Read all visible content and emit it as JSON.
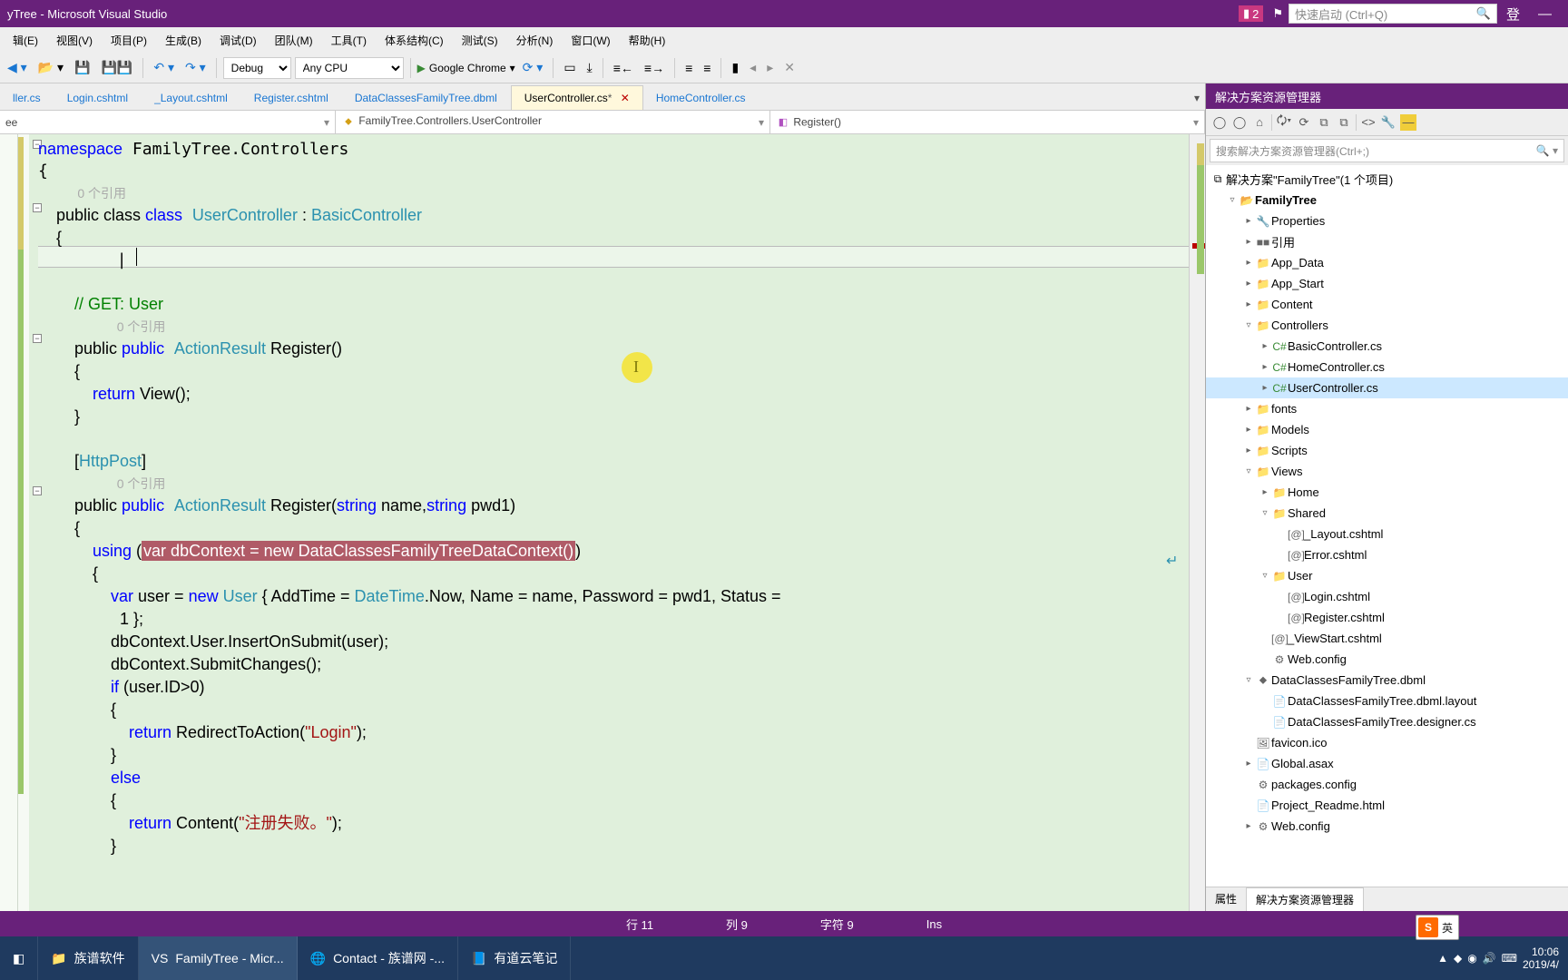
{
  "title": "yTree - Microsoft Visual Studio",
  "notif_badge": "2",
  "quicklaunch_placeholder": "快速启动 (Ctrl+Q)",
  "login_label": "登",
  "menu": [
    "辑(E)",
    "视图(V)",
    "项目(P)",
    "生成(B)",
    "调试(D)",
    "团队(M)",
    "工具(T)",
    "体系结构(C)",
    "测试(S)",
    "分析(N)",
    "窗口(W)",
    "帮助(H)"
  ],
  "toolbar": {
    "config": "Debug",
    "platform": "Any CPU",
    "browser": "Google Chrome"
  },
  "tabs": [
    {
      "label": "ller.cs"
    },
    {
      "label": "Login.cshtml"
    },
    {
      "label": "_Layout.cshtml"
    },
    {
      "label": "Register.cshtml"
    },
    {
      "label": "DataClassesFamilyTree.dbml"
    },
    {
      "label": "UserController.cs",
      "modified": "*",
      "active": true
    },
    {
      "label": "HomeController.cs"
    }
  ],
  "nav": {
    "left": "ee",
    "mid": "FamilyTree.Controllers.UserController",
    "right": "Register()"
  },
  "code": {
    "l1": "namespace FamilyTree.Controllers",
    "l2": "{",
    "ref0": "0 个引用",
    "l3a": "    public class ",
    "l3b": "UserController",
    "l3c": " : ",
    "l3d": "BasicController",
    "l4": "    {",
    "blank": "",
    "l6": "        // GET: User",
    "ref1": "0 个引用",
    "l7a": "        public ",
    "l7b": "ActionResult",
    "l7c": " Register()",
    "l8": "        {",
    "l9a": "            return",
    "l9b": " View();",
    "l10": "        }",
    "l12a": "        [",
    "l12b": "HttpPost",
    "l12c": "]",
    "ref2": "0 个引用",
    "l13a": "        public ",
    "l13b": "ActionResult",
    "l13c": " Register(",
    "l13d": "string",
    "l13e": " name,",
    "l13f": "string",
    "l13g": " pwd1)",
    "l14": "        {",
    "l15a": "            using",
    "l15b": " (",
    "l15c": "var dbContext = new DataClassesFamilyTreeDataContext()",
    "l15d": ")",
    "l16": "            {",
    "l17a": "                var",
    "l17b": " user = ",
    "l17c": "new ",
    "l17d": "User",
    "l17e": " { AddTime = ",
    "l17f": "DateTime",
    "l17g": ".Now, Name = name, Password = pwd1, Status = ",
    "l18": "                  1 };",
    "l19": "                dbContext.User.InsertOnSubmit(user);",
    "l20": "                dbContext.SubmitChanges();",
    "l21a": "                if",
    "l21b": " (user.ID>0)",
    "l22": "                {",
    "l23a": "                    return",
    "l23b": " RedirectToAction(",
    "l23c": "\"Login\"",
    "l23d": ");",
    "l24": "                }",
    "l25a": "                else",
    "l26": "                {",
    "l27a": "                    return",
    "l27b": " Content(",
    "l27c": "\"注册失败。\"",
    "l27d": ");",
    "l28": "                }"
  },
  "sln": {
    "title": "解决方案资源管理器",
    "search_placeholder": "搜索解决方案资源管理器(Ctrl+;)",
    "root": "解决方案\"FamilyTree\"(1 个项目)",
    "tree": [
      {
        "d": 1,
        "t": "▿",
        "i": "📂",
        "n": "FamilyTree",
        "b": true
      },
      {
        "d": 2,
        "t": "▸",
        "i": "🔧",
        "n": "Properties"
      },
      {
        "d": 2,
        "t": "▸",
        "i": "■■",
        "n": "引用"
      },
      {
        "d": 2,
        "t": "▸",
        "i": "📁",
        "n": "App_Data"
      },
      {
        "d": 2,
        "t": "▸",
        "i": "📁",
        "n": "App_Start"
      },
      {
        "d": 2,
        "t": "▸",
        "i": "📁",
        "n": "Content"
      },
      {
        "d": 2,
        "t": "▿",
        "i": "📁",
        "n": "Controllers"
      },
      {
        "d": 3,
        "t": "▸",
        "i": "C#",
        "n": "BasicController.cs",
        "cs": true
      },
      {
        "d": 3,
        "t": "▸",
        "i": "C#",
        "n": "HomeController.cs",
        "cs": true
      },
      {
        "d": 3,
        "t": "▸",
        "i": "C#",
        "n": "UserController.cs",
        "cs": true,
        "sel": true
      },
      {
        "d": 2,
        "t": "▸",
        "i": "📁",
        "n": "fonts"
      },
      {
        "d": 2,
        "t": "▸",
        "i": "📁",
        "n": "Models"
      },
      {
        "d": 2,
        "t": "▸",
        "i": "📁",
        "n": "Scripts"
      },
      {
        "d": 2,
        "t": "▿",
        "i": "📁",
        "n": "Views"
      },
      {
        "d": 3,
        "t": "▸",
        "i": "📁",
        "n": "Home"
      },
      {
        "d": 3,
        "t": "▿",
        "i": "📁",
        "n": "Shared"
      },
      {
        "d": 4,
        "t": " ",
        "i": "[@]",
        "n": "_Layout.cshtml"
      },
      {
        "d": 4,
        "t": " ",
        "i": "[@]",
        "n": "Error.cshtml"
      },
      {
        "d": 3,
        "t": "▿",
        "i": "📁",
        "n": "User"
      },
      {
        "d": 4,
        "t": " ",
        "i": "[@]",
        "n": "Login.cshtml"
      },
      {
        "d": 4,
        "t": " ",
        "i": "[@]",
        "n": "Register.cshtml"
      },
      {
        "d": 3,
        "t": " ",
        "i": "[@]",
        "n": "_ViewStart.cshtml"
      },
      {
        "d": 3,
        "t": " ",
        "i": "⚙",
        "n": "Web.config"
      },
      {
        "d": 2,
        "t": "▿",
        "i": "⬥",
        "n": "DataClassesFamilyTree.dbml"
      },
      {
        "d": 3,
        "t": " ",
        "i": "📄",
        "n": "DataClassesFamilyTree.dbml.layout"
      },
      {
        "d": 3,
        "t": " ",
        "i": "📄",
        "n": "DataClassesFamilyTree.designer.cs"
      },
      {
        "d": 2,
        "t": " ",
        "i": "🖼",
        "n": "favicon.ico"
      },
      {
        "d": 2,
        "t": "▸",
        "i": "📄",
        "n": "Global.asax"
      },
      {
        "d": 2,
        "t": " ",
        "i": "⚙",
        "n": "packages.config"
      },
      {
        "d": 2,
        "t": " ",
        "i": "📄",
        "n": "Project_Readme.html"
      },
      {
        "d": 2,
        "t": "▸",
        "i": "⚙",
        "n": "Web.config"
      }
    ],
    "bottom_tabs": [
      "属性",
      "解决方案资源管理器"
    ]
  },
  "status": {
    "line": "行 11",
    "col": "列 9",
    "char": "字符 9",
    "ins": "Ins"
  },
  "taskbar": {
    "items": [
      {
        "icon": "📁",
        "label": "族谱软件"
      },
      {
        "icon": "VS",
        "label": "FamilyTree - Micr...",
        "active": true
      },
      {
        "icon": "🌐",
        "label": "Contact - 族谱网 -..."
      },
      {
        "icon": "📘",
        "label": "有道云笔记"
      }
    ],
    "ime": {
      "s": "S",
      "t": "英"
    },
    "time": "10:06",
    "date": "2019/4/"
  }
}
